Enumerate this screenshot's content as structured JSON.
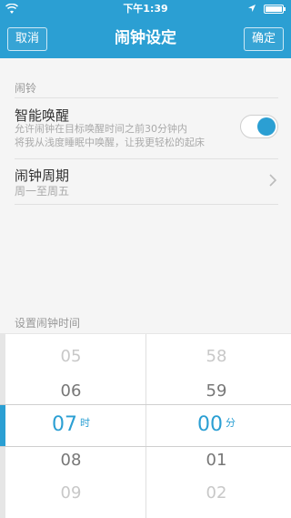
{
  "status_bar": {
    "time": "下午1:39"
  },
  "navbar": {
    "cancel": "取消",
    "title": "闹钟设定",
    "confirm": "确定"
  },
  "section": {
    "alarm": "闹铃"
  },
  "smart_wake": {
    "title": "智能唤醒",
    "desc_line1": "允许闹钟在目标唤醒时间之前30分钟内",
    "desc_line2": "将我从浅度睡眠中唤醒，让我更轻松的起床",
    "enabled": true
  },
  "cycle": {
    "title": "闹钟周期",
    "value": "周一至周五"
  },
  "picker": {
    "label": "设置闹钟时间",
    "hours": [
      "05",
      "06",
      "07",
      "08",
      "09"
    ],
    "minutes": [
      "58",
      "59",
      "00",
      "01",
      "02"
    ],
    "hour_unit": "时",
    "minute_unit": "分",
    "selected_hour": "07",
    "selected_minute": "00"
  },
  "colors": {
    "accent": "#2b9fd3",
    "background": "#f5f5f5"
  },
  "icons": {
    "wifi": "wifi-icon",
    "location": "location-arrow-icon",
    "battery": "battery-icon",
    "chevron": "chevron-right-icon"
  }
}
